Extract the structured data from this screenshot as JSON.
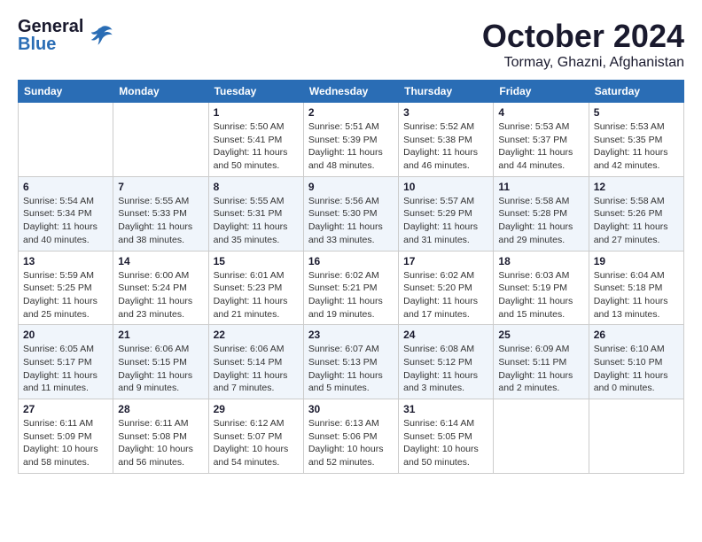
{
  "header": {
    "logo_general": "General",
    "logo_blue": "Blue",
    "month_title": "October 2024",
    "location": "Tormay, Ghazni, Afghanistan"
  },
  "days_of_week": [
    "Sunday",
    "Monday",
    "Tuesday",
    "Wednesday",
    "Thursday",
    "Friday",
    "Saturday"
  ],
  "weeks": [
    [
      {
        "day": "",
        "info": ""
      },
      {
        "day": "",
        "info": ""
      },
      {
        "day": "1",
        "info": "Sunrise: 5:50 AM\nSunset: 5:41 PM\nDaylight: 11 hours and 50 minutes."
      },
      {
        "day": "2",
        "info": "Sunrise: 5:51 AM\nSunset: 5:39 PM\nDaylight: 11 hours and 48 minutes."
      },
      {
        "day": "3",
        "info": "Sunrise: 5:52 AM\nSunset: 5:38 PM\nDaylight: 11 hours and 46 minutes."
      },
      {
        "day": "4",
        "info": "Sunrise: 5:53 AM\nSunset: 5:37 PM\nDaylight: 11 hours and 44 minutes."
      },
      {
        "day": "5",
        "info": "Sunrise: 5:53 AM\nSunset: 5:35 PM\nDaylight: 11 hours and 42 minutes."
      }
    ],
    [
      {
        "day": "6",
        "info": "Sunrise: 5:54 AM\nSunset: 5:34 PM\nDaylight: 11 hours and 40 minutes."
      },
      {
        "day": "7",
        "info": "Sunrise: 5:55 AM\nSunset: 5:33 PM\nDaylight: 11 hours and 38 minutes."
      },
      {
        "day": "8",
        "info": "Sunrise: 5:55 AM\nSunset: 5:31 PM\nDaylight: 11 hours and 35 minutes."
      },
      {
        "day": "9",
        "info": "Sunrise: 5:56 AM\nSunset: 5:30 PM\nDaylight: 11 hours and 33 minutes."
      },
      {
        "day": "10",
        "info": "Sunrise: 5:57 AM\nSunset: 5:29 PM\nDaylight: 11 hours and 31 minutes."
      },
      {
        "day": "11",
        "info": "Sunrise: 5:58 AM\nSunset: 5:28 PM\nDaylight: 11 hours and 29 minutes."
      },
      {
        "day": "12",
        "info": "Sunrise: 5:58 AM\nSunset: 5:26 PM\nDaylight: 11 hours and 27 minutes."
      }
    ],
    [
      {
        "day": "13",
        "info": "Sunrise: 5:59 AM\nSunset: 5:25 PM\nDaylight: 11 hours and 25 minutes."
      },
      {
        "day": "14",
        "info": "Sunrise: 6:00 AM\nSunset: 5:24 PM\nDaylight: 11 hours and 23 minutes."
      },
      {
        "day": "15",
        "info": "Sunrise: 6:01 AM\nSunset: 5:23 PM\nDaylight: 11 hours and 21 minutes."
      },
      {
        "day": "16",
        "info": "Sunrise: 6:02 AM\nSunset: 5:21 PM\nDaylight: 11 hours and 19 minutes."
      },
      {
        "day": "17",
        "info": "Sunrise: 6:02 AM\nSunset: 5:20 PM\nDaylight: 11 hours and 17 minutes."
      },
      {
        "day": "18",
        "info": "Sunrise: 6:03 AM\nSunset: 5:19 PM\nDaylight: 11 hours and 15 minutes."
      },
      {
        "day": "19",
        "info": "Sunrise: 6:04 AM\nSunset: 5:18 PM\nDaylight: 11 hours and 13 minutes."
      }
    ],
    [
      {
        "day": "20",
        "info": "Sunrise: 6:05 AM\nSunset: 5:17 PM\nDaylight: 11 hours and 11 minutes."
      },
      {
        "day": "21",
        "info": "Sunrise: 6:06 AM\nSunset: 5:15 PM\nDaylight: 11 hours and 9 minutes."
      },
      {
        "day": "22",
        "info": "Sunrise: 6:06 AM\nSunset: 5:14 PM\nDaylight: 11 hours and 7 minutes."
      },
      {
        "day": "23",
        "info": "Sunrise: 6:07 AM\nSunset: 5:13 PM\nDaylight: 11 hours and 5 minutes."
      },
      {
        "day": "24",
        "info": "Sunrise: 6:08 AM\nSunset: 5:12 PM\nDaylight: 11 hours and 3 minutes."
      },
      {
        "day": "25",
        "info": "Sunrise: 6:09 AM\nSunset: 5:11 PM\nDaylight: 11 hours and 2 minutes."
      },
      {
        "day": "26",
        "info": "Sunrise: 6:10 AM\nSunset: 5:10 PM\nDaylight: 11 hours and 0 minutes."
      }
    ],
    [
      {
        "day": "27",
        "info": "Sunrise: 6:11 AM\nSunset: 5:09 PM\nDaylight: 10 hours and 58 minutes."
      },
      {
        "day": "28",
        "info": "Sunrise: 6:11 AM\nSunset: 5:08 PM\nDaylight: 10 hours and 56 minutes."
      },
      {
        "day": "29",
        "info": "Sunrise: 6:12 AM\nSunset: 5:07 PM\nDaylight: 10 hours and 54 minutes."
      },
      {
        "day": "30",
        "info": "Sunrise: 6:13 AM\nSunset: 5:06 PM\nDaylight: 10 hours and 52 minutes."
      },
      {
        "day": "31",
        "info": "Sunrise: 6:14 AM\nSunset: 5:05 PM\nDaylight: 10 hours and 50 minutes."
      },
      {
        "day": "",
        "info": ""
      },
      {
        "day": "",
        "info": ""
      }
    ]
  ]
}
